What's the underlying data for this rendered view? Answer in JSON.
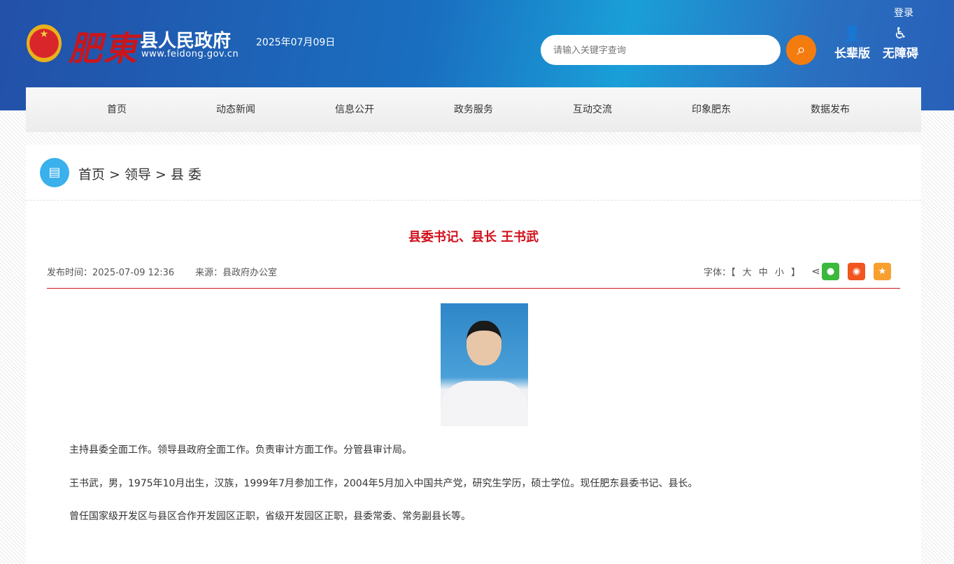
{
  "header": {
    "logo_text": "肥東",
    "site_name": "县人民政府",
    "url": "www.feidong.gov.cn",
    "date": "2025年07月09日",
    "login": "登录",
    "search_placeholder": "请输入关键字查询",
    "elder": "长辈版",
    "accessible": "无障碍"
  },
  "nav": [
    "首页",
    "动态新闻",
    "信息公开",
    "政务服务",
    "互动交流",
    "印象肥东",
    "数据发布"
  ],
  "breadcrumb": "首页 > 领导 > 县 委",
  "article": {
    "title": "县委书记、县长 王书武",
    "publish": "发布时间：2025-07-09 12:36",
    "source": "来源：县政府办公室",
    "font_label": "字体：【 大 中 小 】",
    "paragraphs": [
      "主持县委全面工作。领导县政府全面工作。负责审计方面工作。分管县审计局。",
      "王书武，男，1975年10月出生，汉族，1999年7月参加工作，2004年5月加入中国共产党，研究生学历，硕士学位。现任肥东县委书记、县长。",
      "曾任国家级开发区与县区合作开发园区正职，省级开发园区正职，县委常委、常务副县长等。"
    ]
  },
  "colors": {
    "accent": "#c8161d",
    "search": "#f47c0f",
    "wechat": "#3cb83c",
    "weibo": "#f0561e",
    "qzone": "#f7a030"
  }
}
